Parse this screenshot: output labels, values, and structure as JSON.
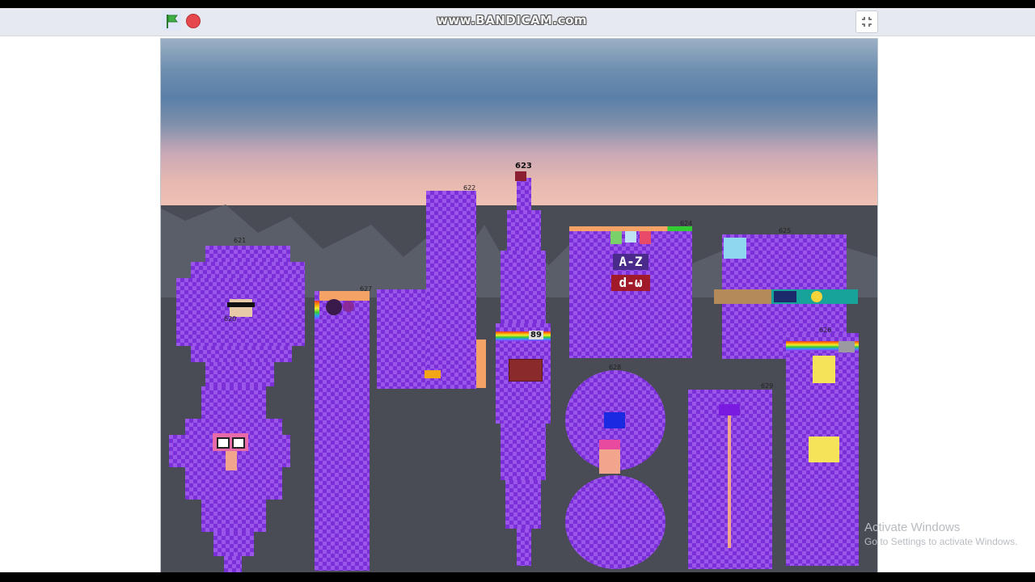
{
  "recorder": {
    "watermark": "www.BANDICAM.com"
  },
  "controls": {
    "green_flag": "green-flag-icon",
    "stop": "stop-icon",
    "fullscreen": "fullscreen-icon"
  },
  "stage": {
    "labels": {
      "l621": "621",
      "l620": "620",
      "l627": "627",
      "l622": "622",
      "l623": "623",
      "l89": "89",
      "l624": "624",
      "l625": "625",
      "l626": "626",
      "l628": "628",
      "l629": "629"
    },
    "signs": {
      "az": "A-Z",
      "dw": "d-ω"
    }
  },
  "windows_notice": {
    "title": "Activate Windows",
    "subtitle": "Go to Settings to activate Windows."
  },
  "colors": {
    "block_purple": "#9a55e9",
    "checker_purple": "#7a2fd8",
    "stop_red": "#e5484d",
    "flag_green": "#2e9e3a"
  }
}
